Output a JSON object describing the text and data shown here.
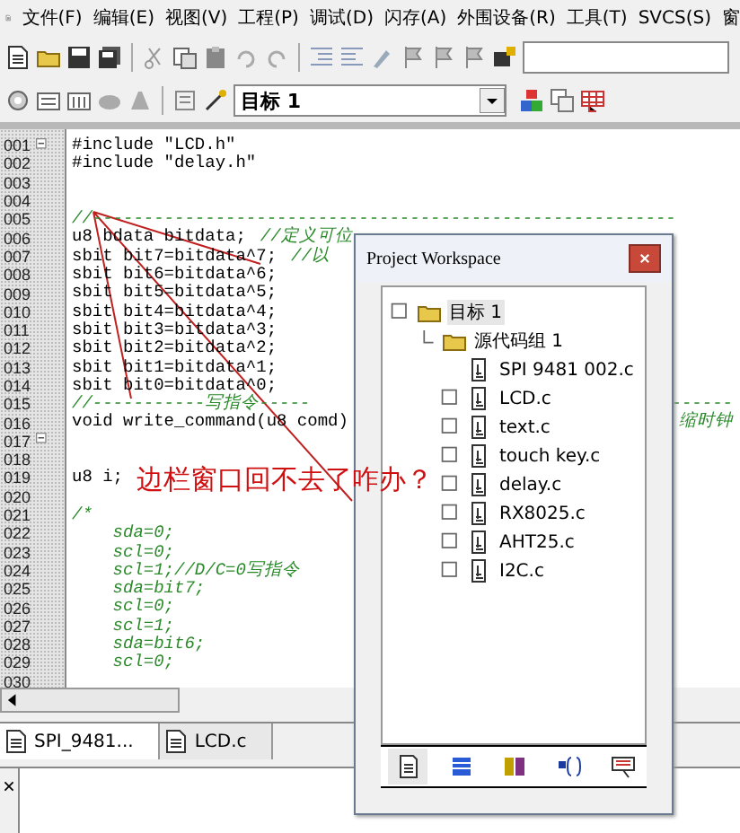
{
  "menu": [
    "文件(F)",
    "编辑(E)",
    "视图(V)",
    "工程(P)",
    "调试(D)",
    "闪存(A)",
    "外围设备(R)",
    "工具(T)",
    "SVCS(S)",
    "窗"
  ],
  "target_select": {
    "value": "目标 1"
  },
  "code_lines": [
    {
      "num": "001",
      "text": "#include \"LCD.h\"",
      "kind": "code",
      "fold": true
    },
    {
      "num": "002",
      "text": "#include \"delay.h\"",
      "kind": "code"
    },
    {
      "num": "003",
      "kind": "code"
    },
    {
      "num": "004",
      "kind": "code"
    },
    {
      "num": "005",
      "text": "//---------------------------------------------------------",
      "kind": "comment"
    },
    {
      "num": "006",
      "text": "u8 bdata bitdata;",
      "comment": "//定义可位",
      "kind": "code"
    },
    {
      "num": "007",
      "text": "sbit bit7=bitdata^7;",
      "comment": "//以",
      "kind": "code"
    },
    {
      "num": "008",
      "text": "sbit bit6=bitdata^6;",
      "kind": "code"
    },
    {
      "num": "009",
      "text": "sbit bit5=bitdata^5;",
      "kind": "code"
    },
    {
      "num": "010",
      "text": "sbit bit4=bitdata^4;",
      "kind": "code"
    },
    {
      "num": "011",
      "text": "sbit bit3=bitdata^3;",
      "kind": "code"
    },
    {
      "num": "012",
      "text": "sbit bit2=bitdata^2;",
      "kind": "code"
    },
    {
      "num": "013",
      "text": "sbit bit1=bitdata^1;",
      "kind": "code"
    },
    {
      "num": "014",
      "text": "sbit bit0=bitdata^0;",
      "kind": "code"
    },
    {
      "num": "015",
      "text": "//-----------写指令-----",
      "comment": "------",
      "kind": "comment"
    },
    {
      "num": "016",
      "text": "void write_command(u8 comd)",
      "comment": "缩时钟",
      "kind": "code"
    },
    {
      "num": "017",
      "kind": "code",
      "fold": true
    },
    {
      "num": "018",
      "kind": "code"
    },
    {
      "num": "019",
      "text": "u8 i;",
      "kind": "code"
    },
    {
      "num": "020",
      "kind": "code"
    },
    {
      "num": "021",
      "text": "/*",
      "kind": "comment"
    },
    {
      "num": "022",
      "text": "    sda=0;",
      "kind": "comment"
    },
    {
      "num": "023",
      "text": "    scl=0;",
      "kind": "comment"
    },
    {
      "num": "024",
      "text": "    scl=1;//D/C=0写指令",
      "kind": "comment"
    },
    {
      "num": "025",
      "text": "    sda=bit7;",
      "kind": "comment"
    },
    {
      "num": "026",
      "text": "    scl=0;",
      "kind": "comment"
    },
    {
      "num": "027",
      "text": "    scl=1;",
      "kind": "comment"
    },
    {
      "num": "028",
      "text": "    sda=bit6;",
      "kind": "comment"
    },
    {
      "num": "029",
      "text": "    scl=0;",
      "kind": "comment"
    },
    {
      "num": "030",
      "kind": "comment"
    }
  ],
  "annotation": "边栏窗口回不去了咋办？",
  "file_tabs": [
    {
      "label": "SPI_9481...",
      "selected": true
    },
    {
      "label": "LCD.c",
      "selected": false
    }
  ],
  "workspace": {
    "title": "Project Workspace",
    "tree": [
      {
        "label": "目标 1",
        "kind": "folder",
        "selected": true,
        "children": [
          {
            "label": "源代码组 1",
            "kind": "folder",
            "selected": false,
            "children": [
              {
                "label": "SPI 9481 002.c",
                "kind": "file",
                "box": false,
                "selected": false
              },
              {
                "label": "LCD.c",
                "kind": "file",
                "box": true,
                "selected": false
              },
              {
                "label": "text.c",
                "kind": "file",
                "box": true,
                "selected": false
              },
              {
                "label": "touch key.c",
                "kind": "file",
                "box": true,
                "selected": false
              },
              {
                "label": "delay.c",
                "kind": "file",
                "box": true,
                "selected": false
              },
              {
                "label": "RX8025.c",
                "kind": "file",
                "box": true,
                "selected": false
              },
              {
                "label": "AHT25.c",
                "kind": "file",
                "box": true,
                "selected": false
              },
              {
                "label": "I2C.c",
                "kind": "file",
                "box": true,
                "selected": false
              }
            ]
          }
        ]
      }
    ],
    "tabs": [
      {
        "kind": "files",
        "selected": true
      },
      {
        "kind": "regs",
        "selected": false
      },
      {
        "kind": "books",
        "selected": false
      },
      {
        "kind": "functions",
        "selected": false
      },
      {
        "kind": "templates",
        "selected": false
      }
    ]
  }
}
